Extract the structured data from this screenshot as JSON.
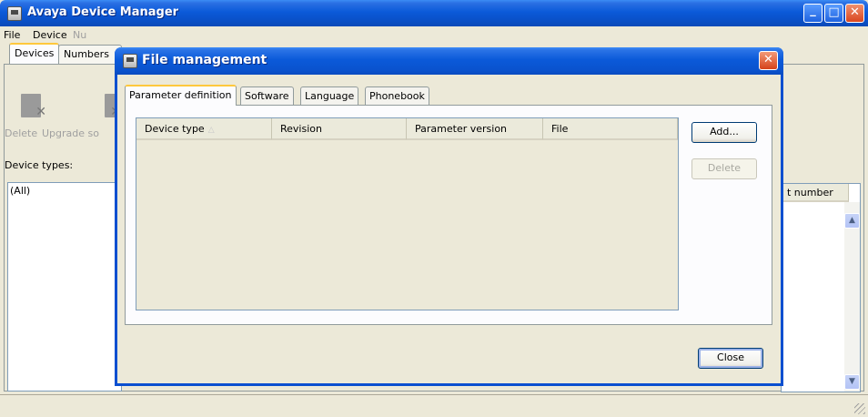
{
  "main_window": {
    "title": "Avaya Device Manager",
    "menu": [
      "File",
      "Device",
      "Nu"
    ],
    "tabs": [
      "Devices",
      "Numbers"
    ],
    "toolbar": {
      "delete_label": "Delete",
      "upgrade_label": "Upgrade so"
    },
    "device_types_label": "Device types:",
    "device_type_items": [
      "(All)"
    ],
    "right_column_header": "t number"
  },
  "dialog": {
    "title": "File management",
    "tabs": [
      "Parameter definition",
      "Software",
      "Language",
      "Phonebook"
    ],
    "active_tab": "Parameter definition",
    "table": {
      "columns": [
        "Device type",
        "Revision",
        "Parameter version",
        "File"
      ],
      "sort_indicator": "△",
      "rows": []
    },
    "add_button": "Add...",
    "delete_button": "Delete",
    "close_button": "Close"
  },
  "window_controls": {
    "minimize": "_",
    "maximize": "□",
    "close": "✕"
  },
  "colors": {
    "titlebar": "#0b5ad9",
    "face": "#ece9d8",
    "tab_accent": "#ffc83c"
  }
}
